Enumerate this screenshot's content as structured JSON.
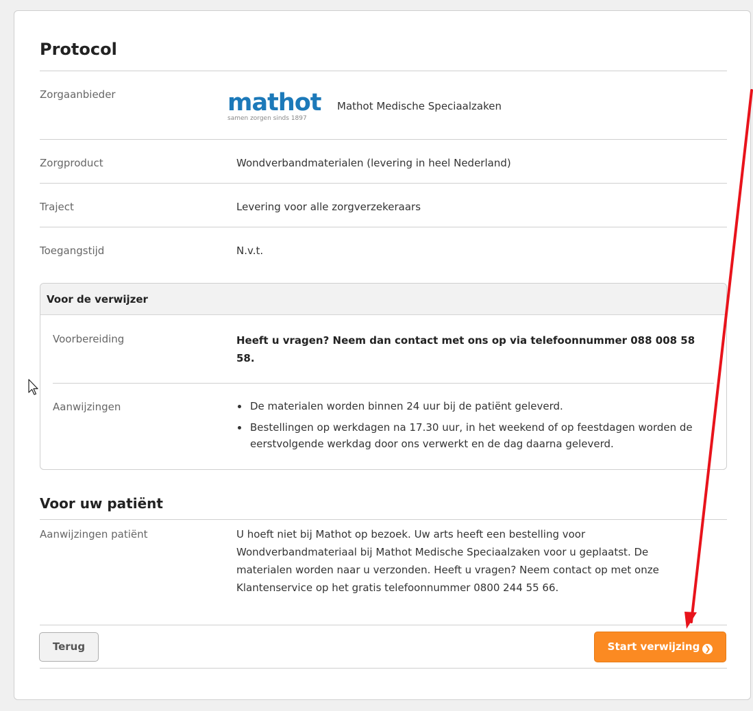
{
  "protocol": {
    "title": "Protocol",
    "rows": [
      {
        "label": "Zorgaanbieder",
        "value": "Mathot Medische Speciaalzaken"
      },
      {
        "label": "Zorgproduct",
        "value": "Wondverbandmaterialen (levering in heel Nederland)"
      },
      {
        "label": "Traject",
        "value": "Levering voor alle zorgverzekeraars"
      },
      {
        "label": "Toegangstijd",
        "value": "N.v.t."
      }
    ],
    "logo": {
      "word": "mathot",
      "tagline": "samen zorgen sinds 1897",
      "color": "#1c79b9"
    }
  },
  "verwijzer": {
    "title": "Voor de verwijzer",
    "voorbereiding_label": "Voorbereiding",
    "voorbereiding_text": "Heeft u vragen? Neem dan contact met ons op via telefoonnummer 088 008 58 58.",
    "aanwijzingen_label": "Aanwijzingen",
    "aanwijzingen": [
      "De materialen worden binnen 24 uur bij de patiënt geleverd.",
      "Bestellingen op werkdagen na 17.30 uur, in het weekend of op feestdagen worden de eerstvolgende werkdag door ons verwerkt en de dag daarna geleverd."
    ]
  },
  "patient": {
    "title": "Voor uw patiënt",
    "label": "Aanwijzingen patiënt",
    "text": "U hoeft niet bij Mathot op bezoek. Uw arts heeft een bestelling voor Wondverbandmateriaal bij Mathot Medische Speciaalzaken voor u geplaatst. De materialen worden naar u verzonden. Heeft u vragen? Neem contact op met onze Klantenservice op het gratis telefoonnummer 0800 244 55 66."
  },
  "actions": {
    "back_label": "Terug",
    "start_label": "Start verwijzing",
    "start_color": "#fb8a22"
  },
  "annotation": {
    "arrow_color": "#e8131b",
    "icon": "cursor-icon"
  }
}
